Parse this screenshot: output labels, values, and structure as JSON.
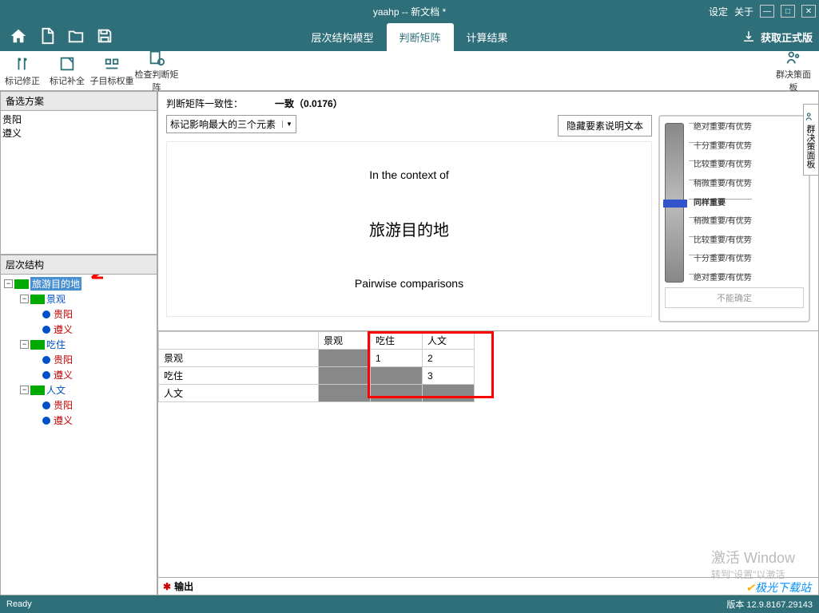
{
  "titlebar": {
    "title": "yaahp -- 新文档 *",
    "settings": "设定",
    "about": "关于"
  },
  "menutabs": {
    "t1": "层次结构模型",
    "t2": "判断矩阵",
    "t3": "计算结果",
    "formal": "获取正式版"
  },
  "toolbar": {
    "b1": "标记修正",
    "b2": "标记补全",
    "b3": "子目标权重",
    "b4": "检查判断矩阵",
    "b5": "群决策面板"
  },
  "panels": {
    "alt_title": "备选方案",
    "hier_title": "层次结构"
  },
  "alternatives": {
    "a1": "贵阳",
    "a2": "遵义"
  },
  "tree": {
    "root": "旅游目的地",
    "c1": "景观",
    "c1a": "贵阳",
    "c1b": "遵义",
    "c2": "吃住",
    "c2a": "贵阳",
    "c2b": "遵义",
    "c3": "人文",
    "c3a": "贵阳",
    "c3b": "遵义"
  },
  "consistency": {
    "label": "判断矩阵一致性：",
    "val": "一致（0.0176）"
  },
  "dropdown": {
    "label": "标记影响最大的三个元素"
  },
  "hide_btn": "隐藏要素说明文本",
  "context": {
    "line1": "In the context of",
    "goal": "旅游目的地",
    "line2": "Pairwise comparisons"
  },
  "scale": {
    "s1": "绝对重要/有优势",
    "s2": "十分重要/有优势",
    "s3": "比较重要/有优势",
    "s4": "稍微重要/有优势",
    "s5": "同样重要",
    "s6": "稍微重要/有优势",
    "s7": "比较重要/有优势",
    "s8": "十分重要/有优势",
    "s9": "绝对重要/有优势",
    "uncertain": "不能确定"
  },
  "matrix": {
    "h1": "景观",
    "h2": "吃住",
    "h3": "人文",
    "r1": "景观",
    "r2": "吃住",
    "r3": "人文",
    "v12": "1",
    "v13": "2",
    "v23": "3"
  },
  "output": {
    "label": "输出"
  },
  "status": {
    "ready": "Ready",
    "version": "版本 12.9.8167.29143"
  },
  "side": {
    "label": "群决策面板"
  },
  "watermark": {
    "t1": "激活 Window",
    "t2": "转到\"设置\"以激活",
    "logo": "极光下载站"
  }
}
